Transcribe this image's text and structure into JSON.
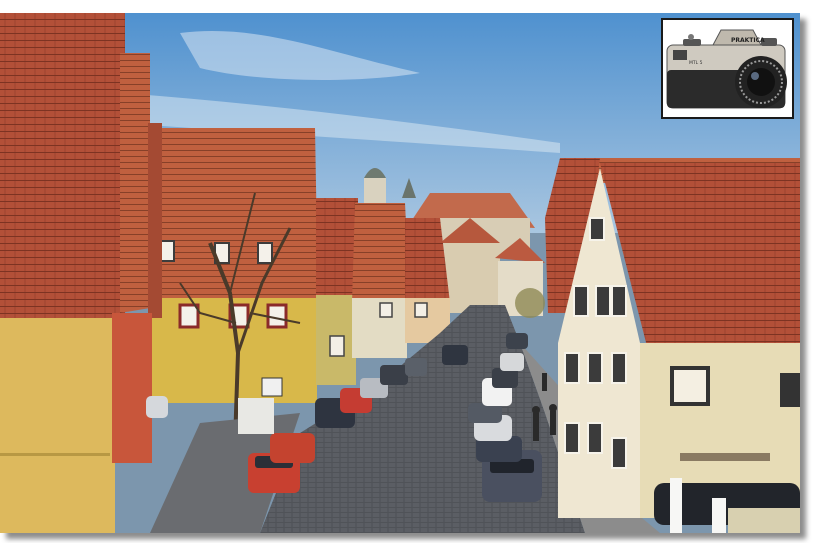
{
  "photo": {
    "scene": "street-scene-photo",
    "sky_color": "#5f9fd6",
    "roof_color": "#b8553a",
    "road_color": "#5a5d63"
  },
  "inset": {
    "icon": "slr-camera-icon",
    "camera_brand": "PRAKTICA",
    "camera_model": "MTL 5"
  }
}
